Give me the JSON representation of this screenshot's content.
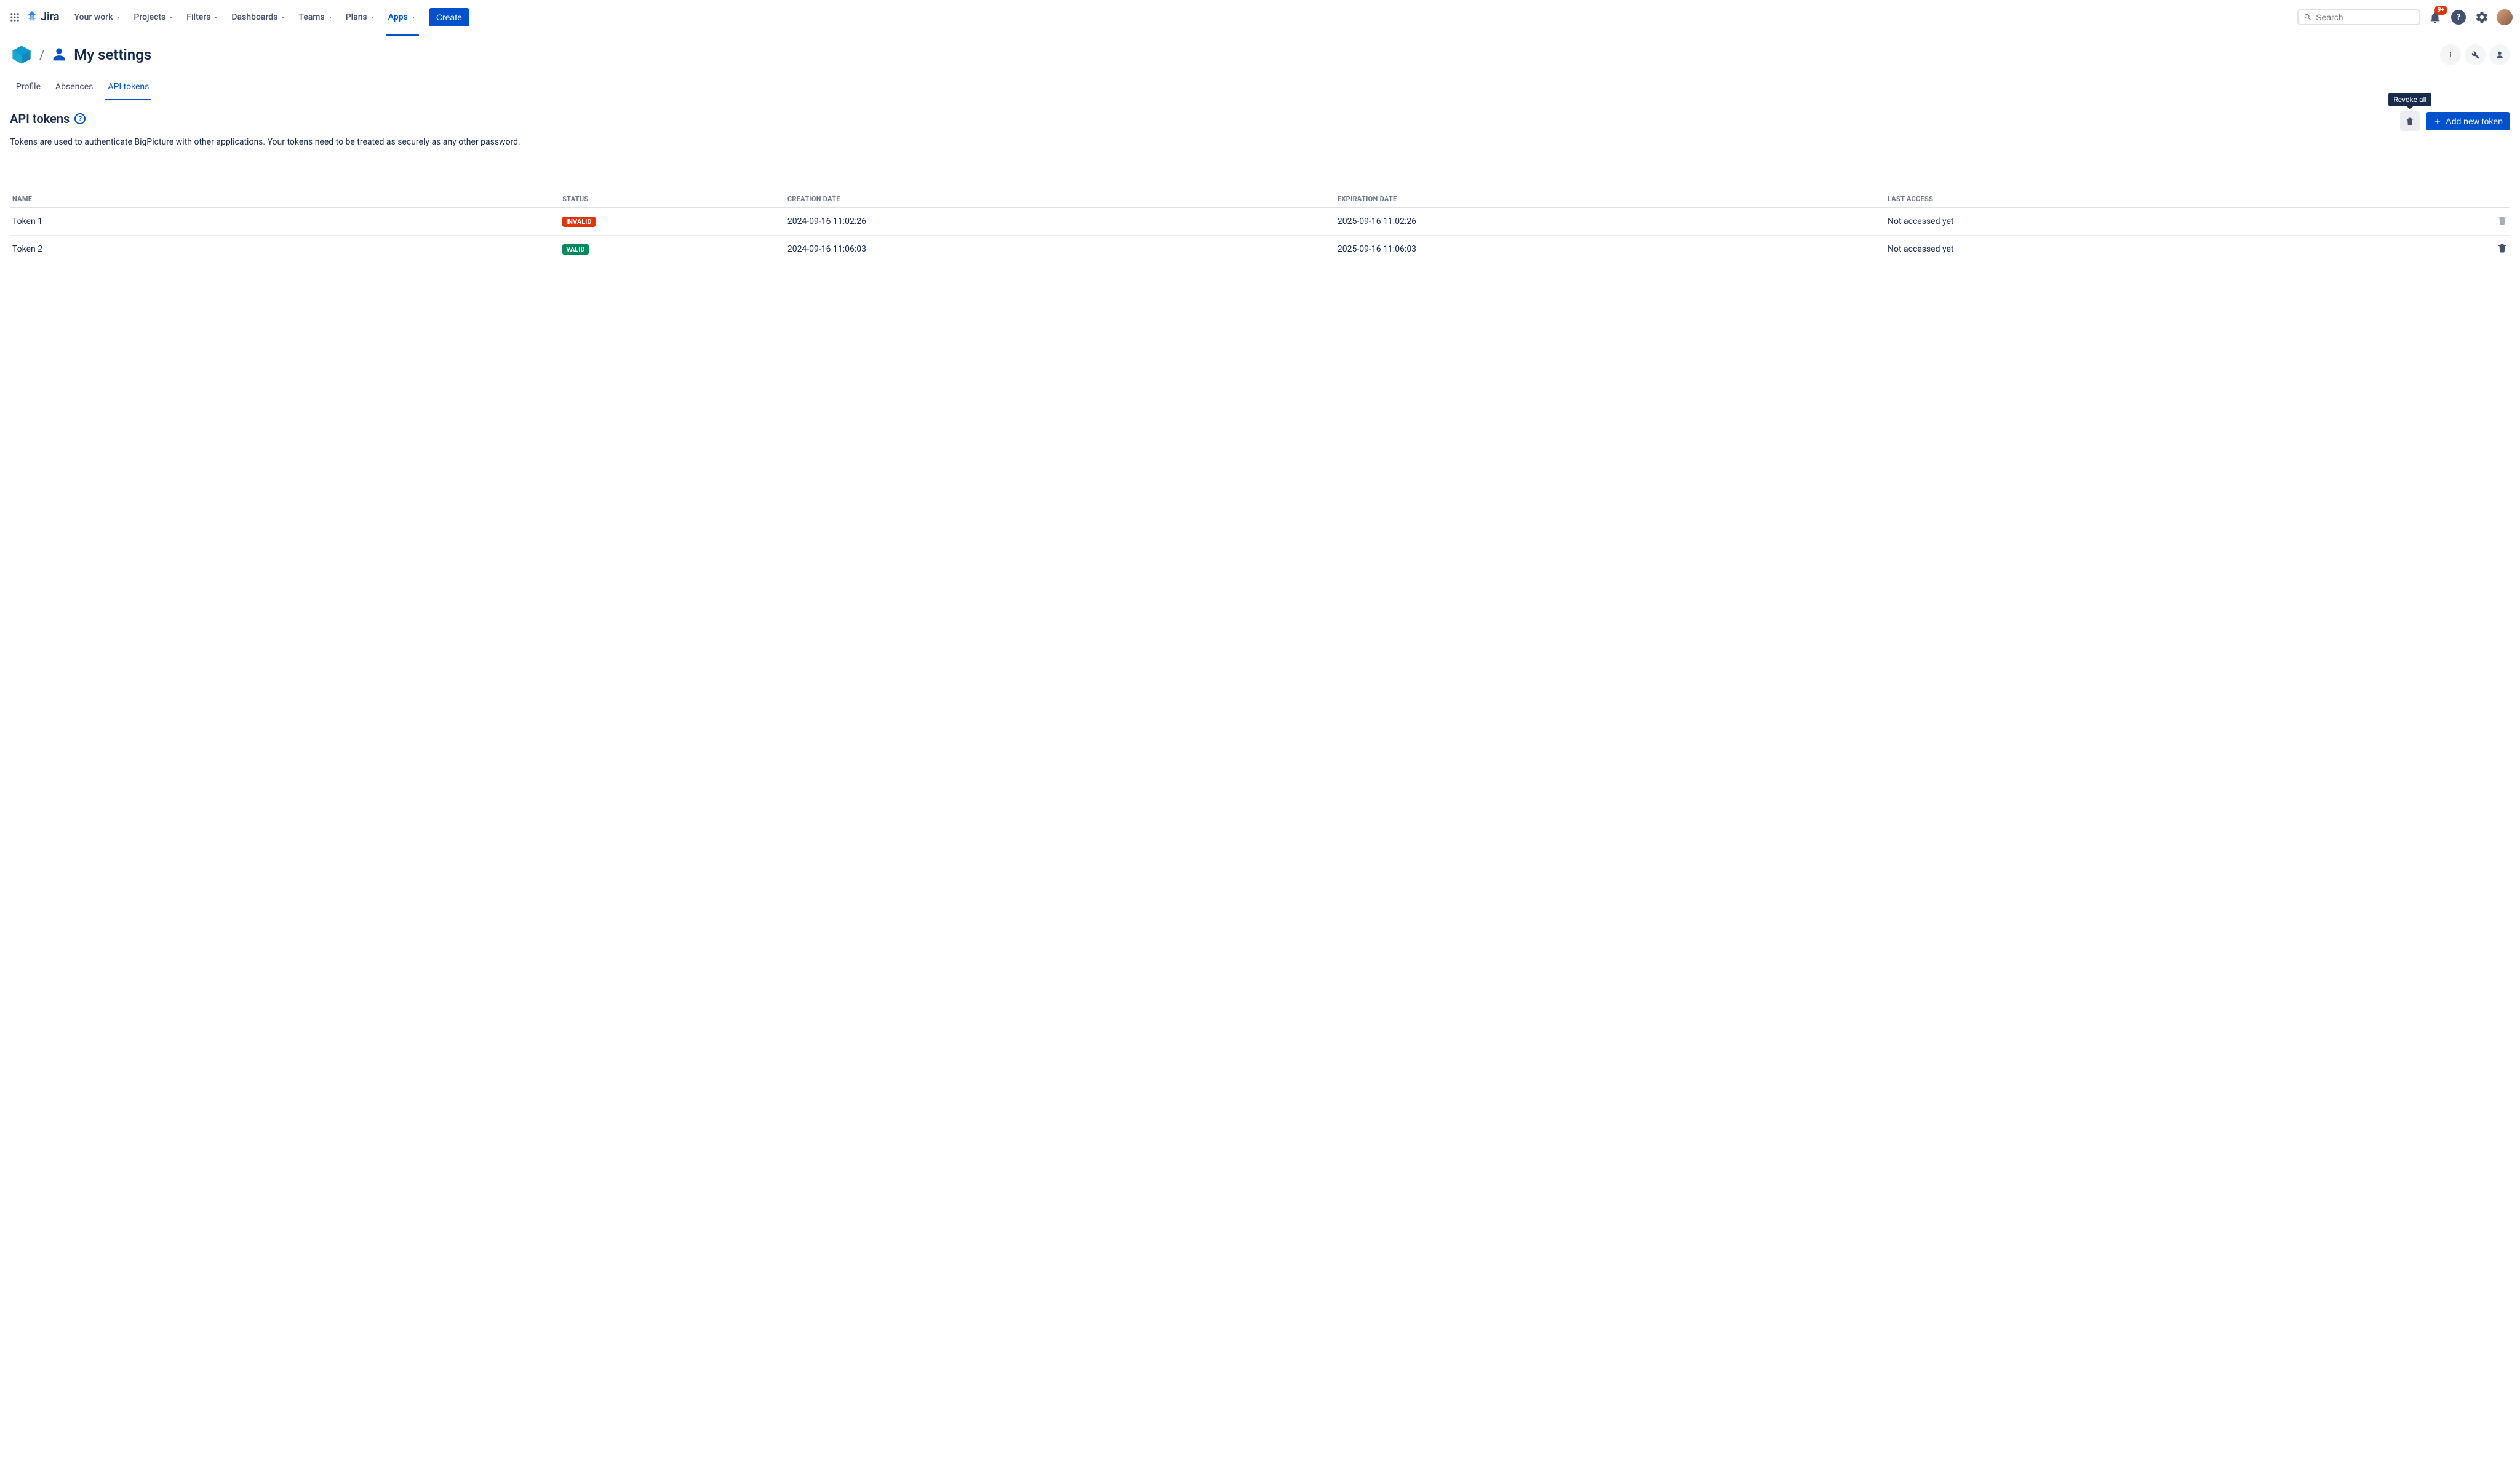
{
  "nav": {
    "product": "Jira",
    "items": [
      {
        "label": "Your work"
      },
      {
        "label": "Projects"
      },
      {
        "label": "Filters"
      },
      {
        "label": "Dashboards"
      },
      {
        "label": "Teams"
      },
      {
        "label": "Plans"
      },
      {
        "label": "Apps",
        "active": true
      }
    ],
    "create_label": "Create",
    "search_placeholder": "Search",
    "notification_badge": "9+"
  },
  "page": {
    "title": "My settings",
    "tabs": [
      {
        "label": "Profile"
      },
      {
        "label": "Absences"
      },
      {
        "label": "API tokens",
        "active": true
      }
    ]
  },
  "section": {
    "title": "API tokens",
    "description": "Tokens are used to authenticate BigPicture with other applications. Your tokens need to be treated as securely as any other password.",
    "revoke_all_tooltip": "Revoke all",
    "add_button": "Add new token"
  },
  "table": {
    "headers": {
      "name": "NAME",
      "status": "STATUS",
      "creation": "CREATION DATE",
      "expiration": "EXPIRATION DATE",
      "last_access": "LAST ACCESS"
    },
    "rows": [
      {
        "name": "Token 1",
        "status": "INVALID",
        "status_kind": "invalid",
        "created": "2024-09-16 11:02:26",
        "expires": "2025-09-16 11:02:26",
        "last_access": "Not accessed yet"
      },
      {
        "name": "Token 2",
        "status": "VALID",
        "status_kind": "valid",
        "created": "2024-09-16 11:06:03",
        "expires": "2025-09-16 11:06:03",
        "last_access": "Not accessed yet"
      }
    ]
  }
}
